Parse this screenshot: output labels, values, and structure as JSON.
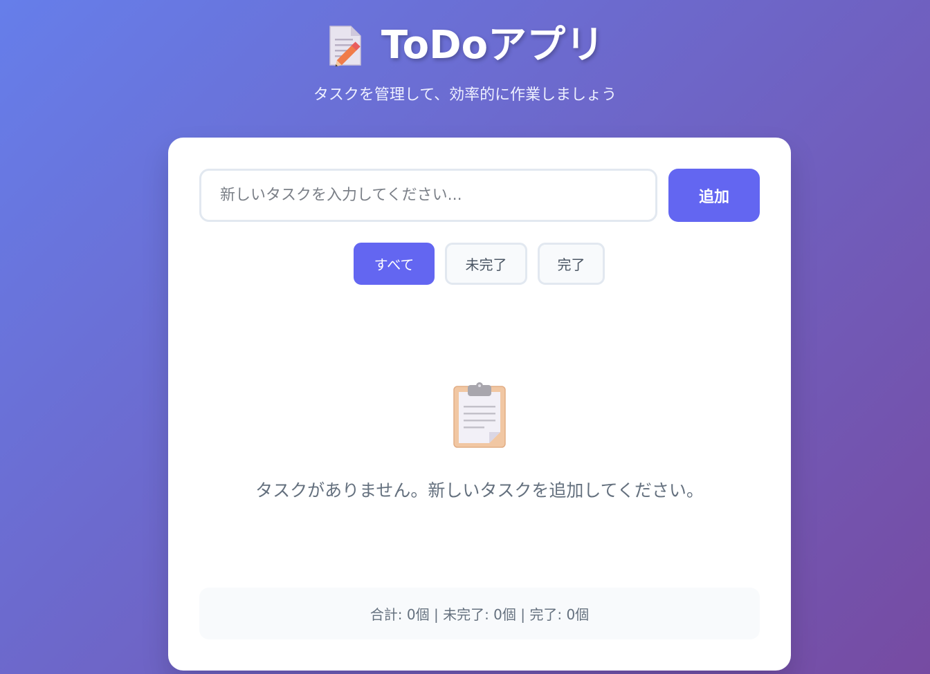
{
  "header": {
    "title": "ToDoアプリ",
    "title_icon": "memo-icon",
    "subtitle": "タスクを管理して、効率的に作業しましょう"
  },
  "input": {
    "placeholder": "新しいタスクを入力してください...",
    "value": ""
  },
  "add_button": {
    "label": "追加"
  },
  "filters": [
    {
      "label": "すべて",
      "active": true
    },
    {
      "label": "未完了",
      "active": false
    },
    {
      "label": "完了",
      "active": false
    }
  ],
  "empty_state": {
    "icon": "clipboard-icon",
    "message": "タスクがありません。新しいタスクを追加してください。"
  },
  "stats": {
    "text": "合計: 0個 | 未完了: 0個 | 完了: 0個"
  },
  "colors": {
    "accent": "#6366f1",
    "background_start": "#667eea",
    "background_end": "#764ba2"
  }
}
